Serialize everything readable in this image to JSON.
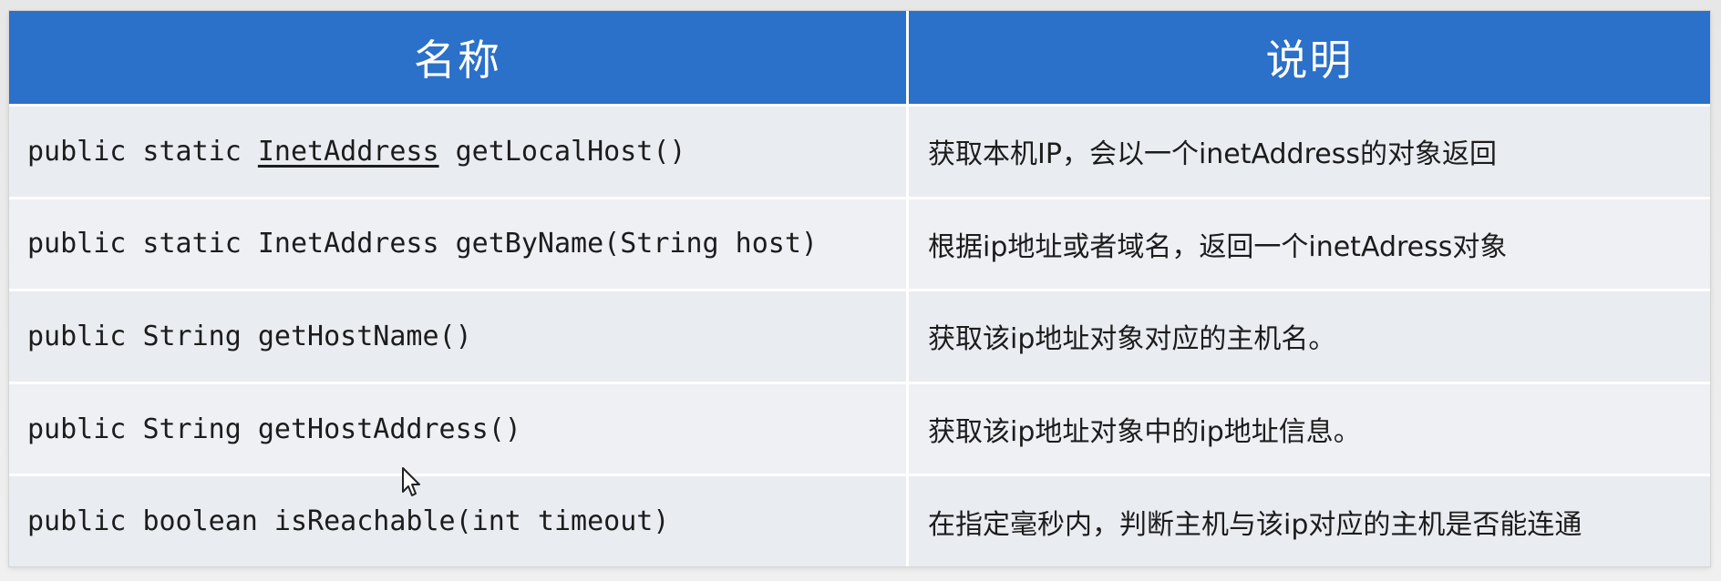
{
  "header": {
    "name": "名称",
    "description": "说明"
  },
  "rows": [
    {
      "sig_prefix": "public static ",
      "sig_type": "InetAddress",
      "sig_suffix": " getLocalHost()",
      "description": "获取本机IP，会以一个inetAddress的对象返回"
    },
    {
      "sig_prefix": "public static ",
      "sig_type": "InetAddress",
      "sig_suffix": " getByName(String host)",
      "description": "根据ip地址或者域名，返回一个inetAdress对象"
    },
    {
      "sig_prefix": "public ",
      "sig_type": "String",
      "sig_suffix": " getHostName()",
      "description": "获取该ip地址对象对应的主机名。"
    },
    {
      "sig_prefix": "public ",
      "sig_type": "String",
      "sig_suffix": " getHostAddress()",
      "description": "获取该ip地址对象中的ip地址信息。"
    },
    {
      "sig_prefix": "public ",
      "sig_type": "boolean",
      "sig_suffix": " isReachable(int timeout)",
      "description": "在指定毫秒内，判断主机与该ip对应的主机是否能连通"
    }
  ],
  "colors": {
    "header_bg": "#2b70c9",
    "row_bg": "#e9ecf1",
    "text": "#1c1c1c"
  },
  "icons": {
    "cursor": "mouse-pointer-icon"
  }
}
